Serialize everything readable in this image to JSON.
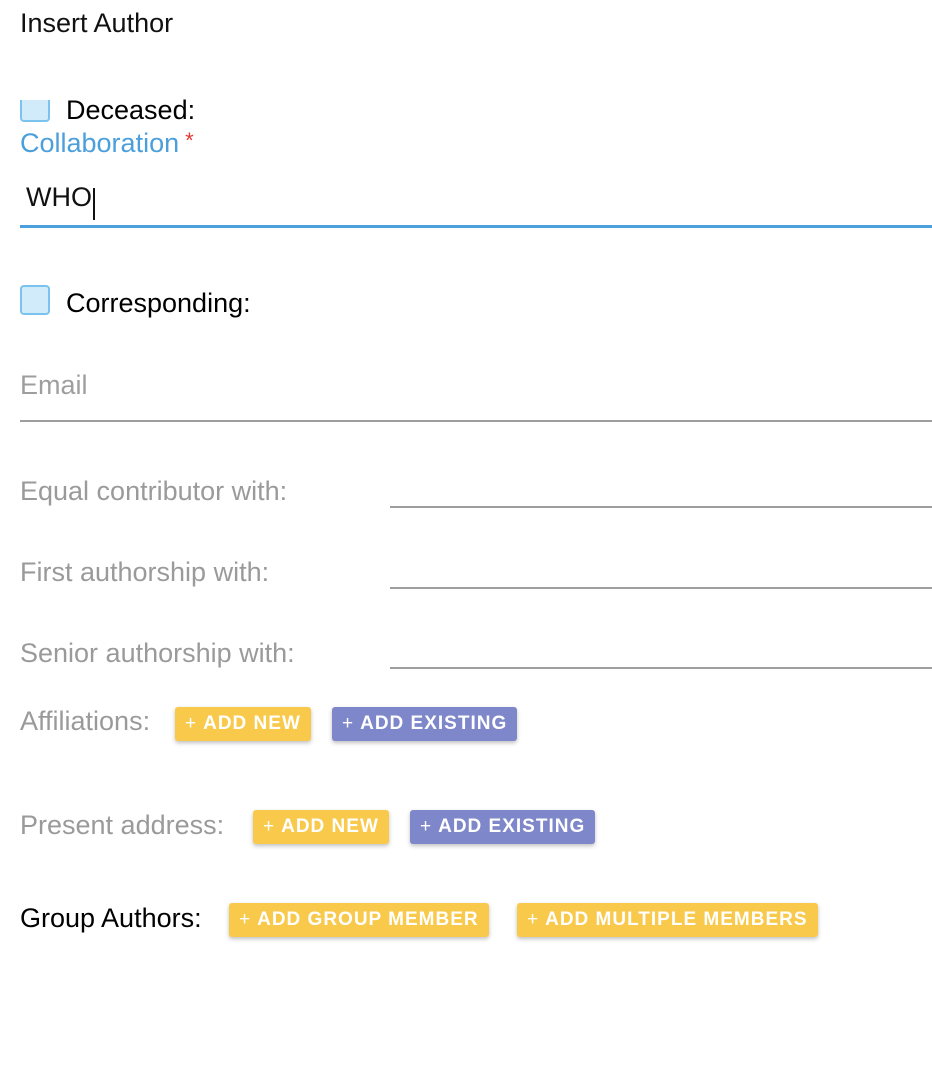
{
  "title": "Insert Author",
  "deceased": {
    "label": "Deceased:",
    "checked": false
  },
  "collaboration": {
    "label": "Collaboration",
    "required_mark": "*",
    "value": "WHO"
  },
  "corresponding": {
    "label": "Corresponding:",
    "checked": false
  },
  "email": {
    "placeholder": "Email",
    "value": ""
  },
  "equal_contributor": {
    "label": "Equal contributor with:"
  },
  "first_authorship": {
    "label": "First authorship with:"
  },
  "senior_authorship": {
    "label": "Senior authorship with:"
  },
  "affiliations": {
    "label": "Affiliations:",
    "add_new": "ADD NEW",
    "add_existing": "ADD EXISTING"
  },
  "present_address": {
    "label": "Present address:",
    "add_new": "ADD NEW",
    "add_existing": "ADD EXISTING"
  },
  "group_authors": {
    "label": "Group Authors:",
    "add_group_member": "ADD GROUP MEMBER",
    "add_multiple_members": "ADD MULTIPLE MEMBERS"
  },
  "icons": {
    "plus": "+"
  },
  "colors": {
    "accent_blue": "#4a9fdc",
    "required_red": "#e53935",
    "button_yellow": "#f8c94b",
    "button_purple": "#7e87c9",
    "checkbox_fill": "#d2ebfb"
  }
}
